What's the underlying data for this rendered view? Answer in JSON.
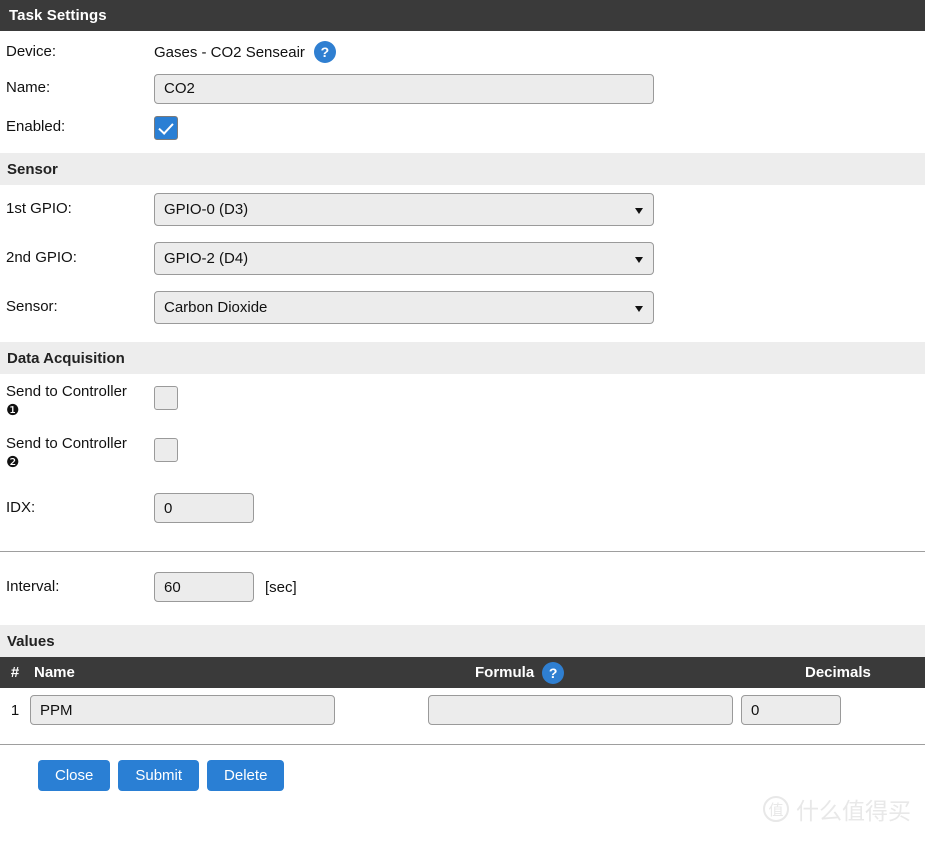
{
  "window": {
    "title": "Task Settings"
  },
  "device": {
    "label": "Device:",
    "value": "Gases - CO2 Senseair",
    "help_icon": "question-mark-icon",
    "help_glyph": "?"
  },
  "name": {
    "label": "Name:",
    "value": "CO2"
  },
  "enabled": {
    "label": "Enabled:",
    "checked": true
  },
  "sensor_section": {
    "title": "Sensor",
    "gpio1": {
      "label": "1st GPIO:",
      "value": "GPIO-0 (D3)"
    },
    "gpio2": {
      "label": "2nd GPIO:",
      "value": "GPIO-2 (D4)"
    },
    "sensor": {
      "label": "Sensor:",
      "value": "Carbon Dioxide"
    }
  },
  "data_acquisition": {
    "title": "Data Acquisition",
    "controller1": {
      "label": "Send to Controller",
      "badge": "❶",
      "checked": false
    },
    "controller2": {
      "label": "Send to Controller",
      "badge": "❷",
      "checked": false
    },
    "idx": {
      "label": "IDX:",
      "value": "0"
    }
  },
  "interval": {
    "label": "Interval:",
    "value": "60",
    "unit": "[sec]"
  },
  "values_section": {
    "title": "Values",
    "columns": {
      "number": "#",
      "name": "Name",
      "formula": "Formula",
      "formula_help_glyph": "?",
      "decimals": "Decimals"
    },
    "rows": [
      {
        "number": "1",
        "name": "PPM",
        "formula": "",
        "decimals": "0"
      }
    ]
  },
  "footer": {
    "close_label": "Close",
    "submit_label": "Submit",
    "delete_label": "Delete"
  },
  "watermark": {
    "logo_glyph": "值",
    "text": "什么值得买"
  },
  "colors": {
    "titlebar_bg": "#3a3a3a",
    "section_bg": "#ededed",
    "accent_blue": "#2a7fd4",
    "help_blue": "#2f7fd1",
    "input_bg": "#ececec",
    "input_border": "#9a9a9a"
  }
}
